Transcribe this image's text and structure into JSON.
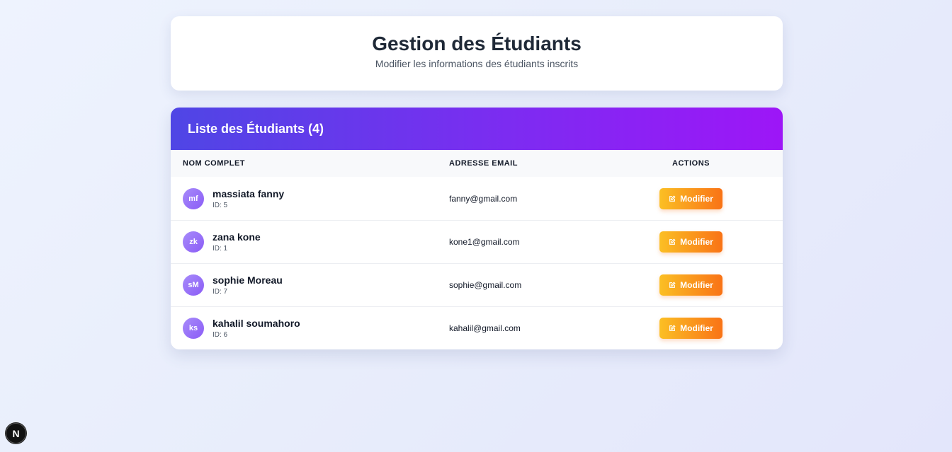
{
  "header": {
    "title": "Gestion des Étudiants",
    "subtitle": "Modifier les informations des étudiants inscrits"
  },
  "list": {
    "title": "Liste des Étudiants (4)",
    "columns": {
      "name": "Nom complet",
      "email": "Adresse Email",
      "actions": "Actions"
    },
    "students": [
      {
        "initials": "mf",
        "name": "massiata fanny",
        "id": "ID: 5",
        "email": "fanny@gmail.com",
        "action": "Modifier"
      },
      {
        "initials": "zk",
        "name": "zana kone",
        "id": "ID: 1",
        "email": "kone1@gmail.com",
        "action": "Modifier"
      },
      {
        "initials": "sM",
        "name": "sophie Moreau",
        "id": "ID: 7",
        "email": "sophie@gmail.com",
        "action": "Modifier"
      },
      {
        "initials": "ks",
        "name": "kahalil soumahoro",
        "id": "ID: 6",
        "email": "kahalil@gmail.com",
        "action": "Modifier"
      }
    ]
  },
  "dev_badge": {
    "label": "N"
  },
  "colors": {
    "accent_start": "#4f46e5",
    "accent_end": "#9d16f7",
    "button_start": "#fbbf24",
    "button_end": "#f97316",
    "avatar": "#8b5cf6"
  },
  "icons": {
    "edit": "edit-icon"
  }
}
